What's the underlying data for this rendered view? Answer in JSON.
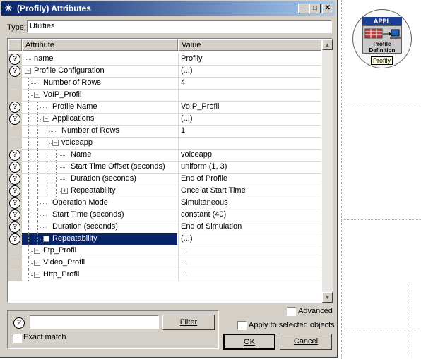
{
  "dialog": {
    "title": "(Profily) Attributes",
    "type_label": "Type:",
    "type_value": "Utilities",
    "columns": [
      "Attribute",
      "Value"
    ],
    "rows": [
      {
        "help": true,
        "attr": "name",
        "value": "Profily"
      },
      {
        "help": true,
        "attr": "Profile Configuration",
        "value": "(...)"
      },
      {
        "help": false,
        "attr": "Number of Rows",
        "value": "4"
      },
      {
        "help": false,
        "attr": "VoIP_Profil",
        "value": ""
      },
      {
        "help": true,
        "attr": "Profile Name",
        "value": "VoIP_Profil"
      },
      {
        "help": true,
        "attr": "Applications",
        "value": "(...)"
      },
      {
        "help": false,
        "attr": "Number of Rows",
        "value": "1"
      },
      {
        "help": false,
        "attr": "voiceapp",
        "value": ""
      },
      {
        "help": true,
        "attr": "Name",
        "value": "voiceapp"
      },
      {
        "help": true,
        "attr": "Start Time Offset (seconds)",
        "value": "uniform (1, 3)"
      },
      {
        "help": true,
        "attr": "Duration (seconds)",
        "value": "End of Profile"
      },
      {
        "help": true,
        "attr": "Repeatability",
        "value": "Once at Start Time"
      },
      {
        "help": true,
        "attr": "Operation Mode",
        "value": "Simultaneous"
      },
      {
        "help": true,
        "attr": "Start Time (seconds)",
        "value": "constant (40)"
      },
      {
        "help": true,
        "attr": "Duration (seconds)",
        "value": "End of Simulation"
      },
      {
        "help": true,
        "attr": "Repeatability",
        "value": "(...)"
      },
      {
        "help": false,
        "attr": "Ftp_Profil",
        "value": "..."
      },
      {
        "help": false,
        "attr": "Video_Profil",
        "value": "..."
      },
      {
        "help": false,
        "attr": "Http_Profil",
        "value": "..."
      }
    ],
    "filter_value": "",
    "filter_button": "Filter",
    "exact_match": "Exact match",
    "advanced": "Advanced",
    "apply_selected": "Apply to selected objects",
    "ok": "OK",
    "cancel": "Cancel",
    "help_glyph": "?"
  },
  "node": {
    "header": "APPL",
    "line1": "Profile",
    "line2": "Definition",
    "tooltip": "Profily"
  }
}
